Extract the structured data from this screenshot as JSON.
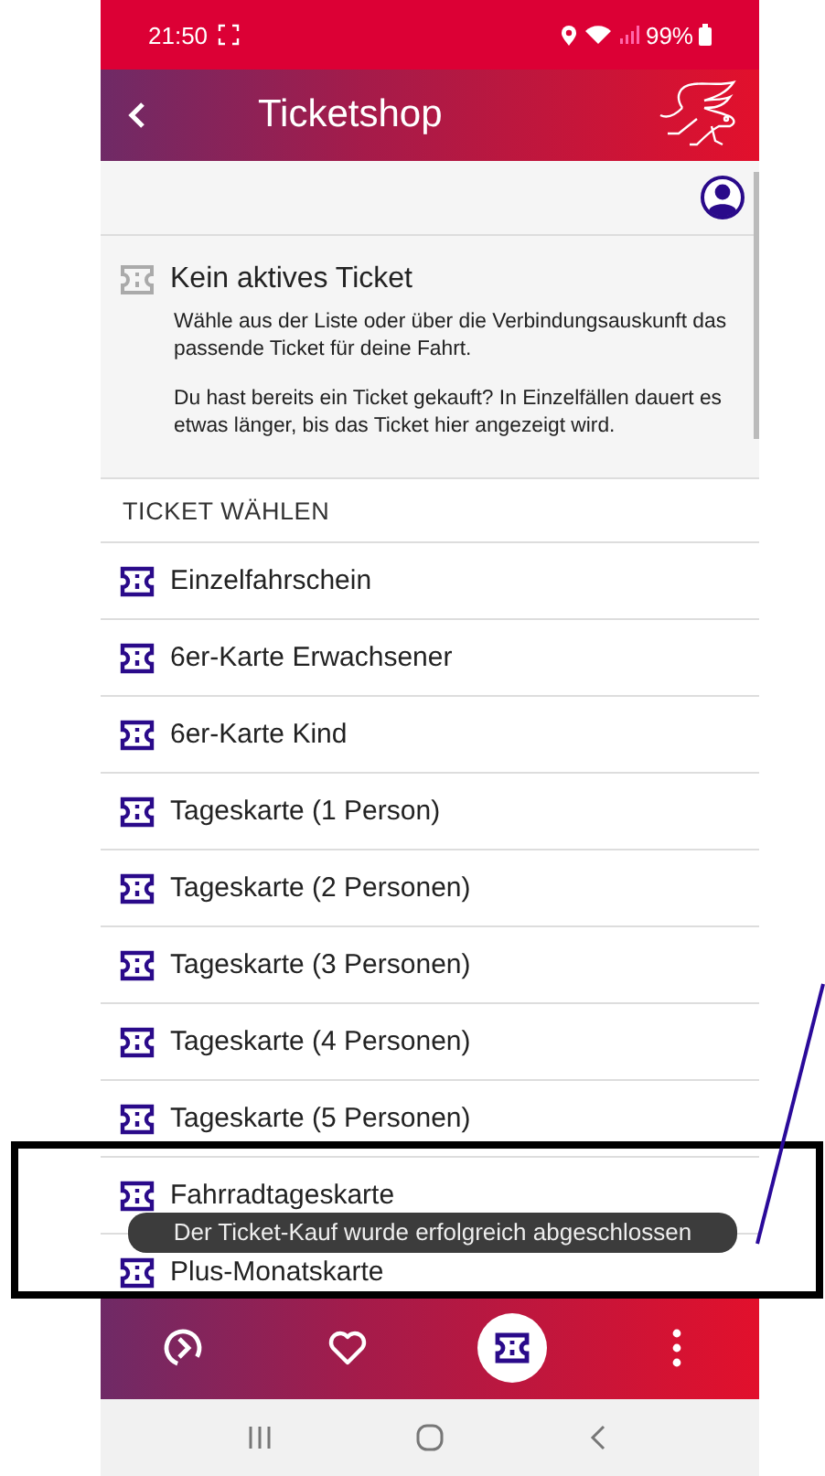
{
  "status_bar": {
    "time": "21:50",
    "battery": "99%"
  },
  "header": {
    "title": "Ticketshop"
  },
  "notice": {
    "title": "Kein aktives Ticket",
    "paragraphs": [
      "Wähle aus der Liste oder über die Verbindungsauskunft das passende Ticket für deine Fahrt.",
      "Du hast bereits ein Ticket gekauft? In Einzelfällen dauert es etwas länger, bis das Ticket hier angezeigt wird."
    ]
  },
  "section_title": "TICKET WÄHLEN",
  "tickets": [
    {
      "label": "Einzelfahrschein"
    },
    {
      "label": "6er-Karte Erwachsener"
    },
    {
      "label": "6er-Karte Kind"
    },
    {
      "label": "Tageskarte (1 Person)"
    },
    {
      "label": "Tageskarte (2 Personen)"
    },
    {
      "label": "Tageskarte (3 Personen)"
    },
    {
      "label": "Tageskarte (4 Personen)"
    },
    {
      "label": "Tageskarte (5 Personen)"
    },
    {
      "label": "Fahrradtageskarte"
    },
    {
      "label": "Plus-Monatskarte"
    }
  ],
  "toast": {
    "message": "Der Ticket-Kauf wurde erfolgreich abgeschlossen"
  },
  "bottom_nav": [
    {
      "kind": "route",
      "selected": false
    },
    {
      "kind": "favorites",
      "selected": false
    },
    {
      "kind": "tickets",
      "selected": true
    },
    {
      "kind": "more",
      "selected": false
    }
  ]
}
